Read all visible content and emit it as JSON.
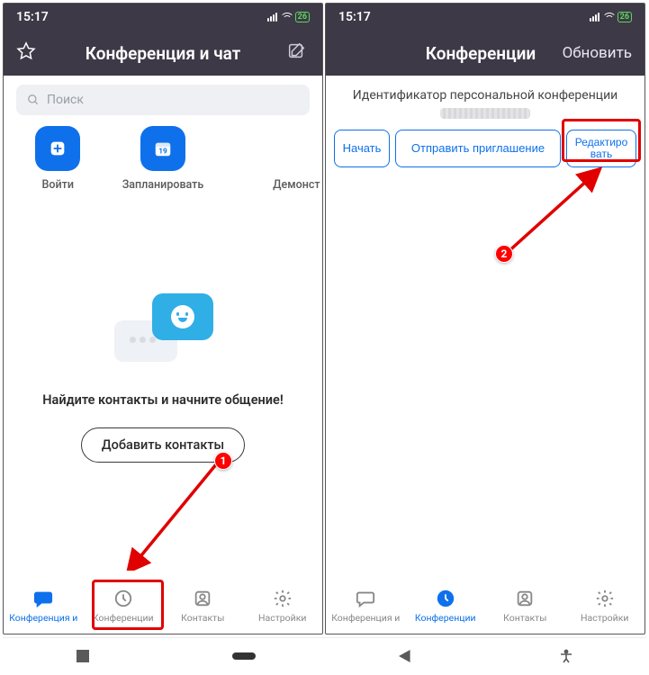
{
  "status": {
    "time": "15:17",
    "battery": "26"
  },
  "left": {
    "header_title": "Конференция и чат",
    "search_placeholder": "Поиск",
    "action_join": "Войти",
    "action_schedule": "Запланировать",
    "schedule_day": "19",
    "action_demo": "Демонстраци",
    "empty_text": "Найдите контакты и начните общение!",
    "add_contacts": "Добавить контакты",
    "nav": [
      "Конференция и",
      "Конференции",
      "Контакты",
      "Настройки"
    ]
  },
  "right": {
    "header_title": "Конференции",
    "header_action": "Обновить",
    "subhead": "Идентификатор персональной конференции",
    "btn_start": "Начать",
    "btn_invite": "Отправить приглашение",
    "btn_edit": "Редактиро вать",
    "nav": [
      "Конференция и",
      "Конференции",
      "Контакты",
      "Настройки"
    ]
  },
  "annotations": {
    "badge1": "1",
    "badge2": "2"
  }
}
